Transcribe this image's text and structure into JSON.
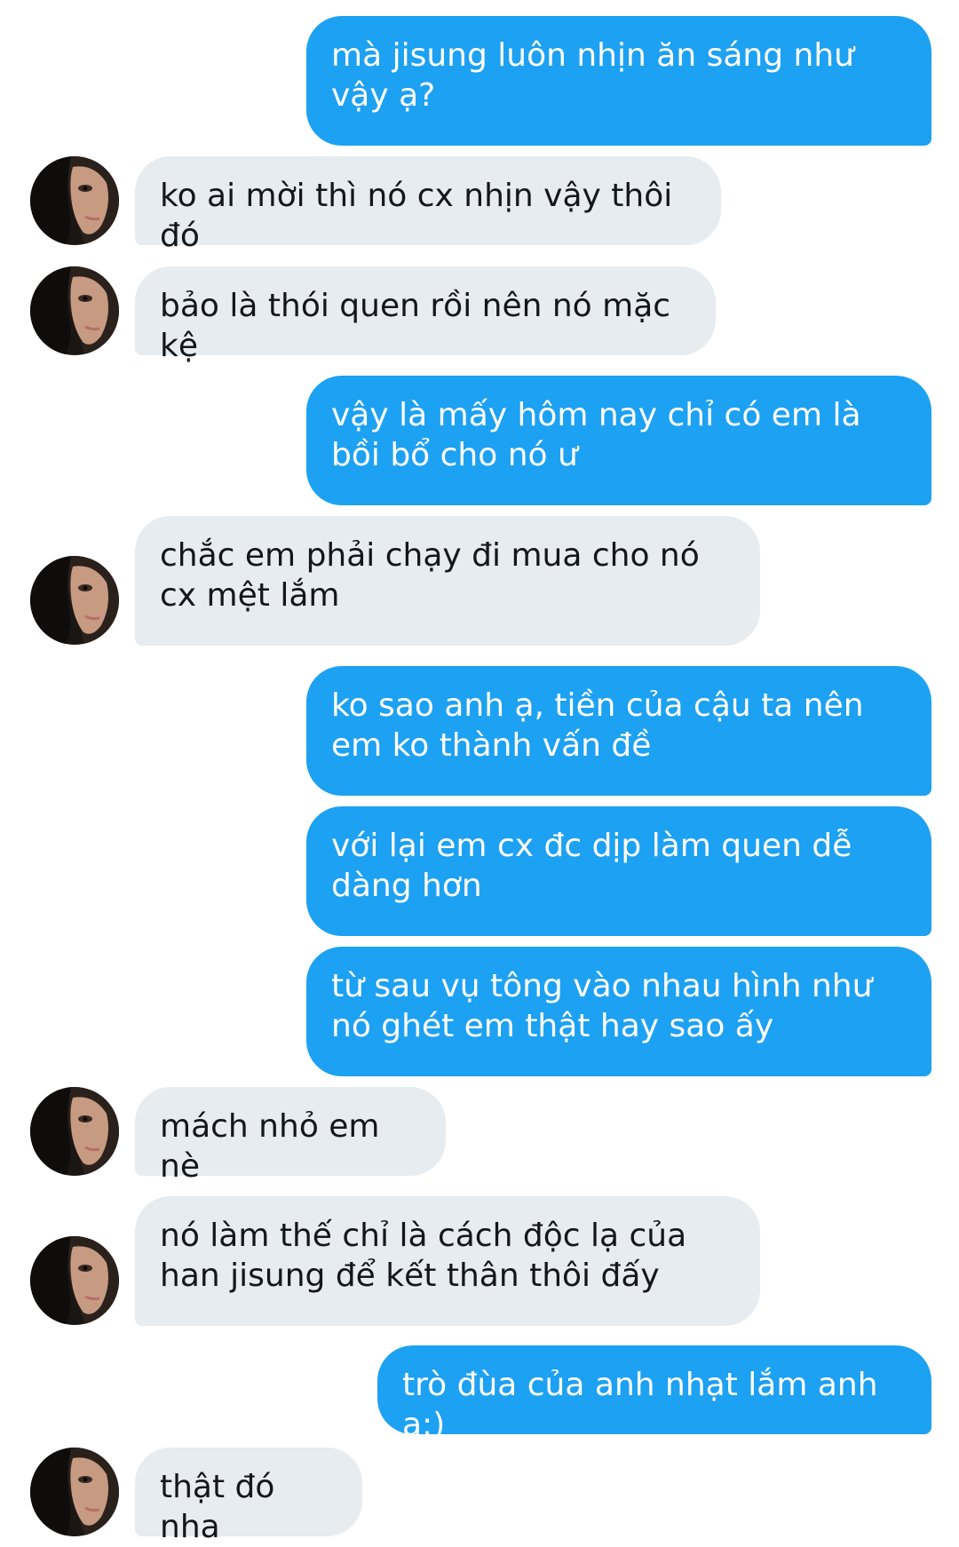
{
  "conversation": {
    "messages": [
      {
        "from": "me",
        "text": "mà jisung luôn nhịn ăn sáng như vậy ạ?"
      },
      {
        "from": "other",
        "text": "ko ai mời thì nó cx nhịn vậy thôi đó"
      },
      {
        "from": "other",
        "text": "bảo là thói quen rồi nên nó mặc kệ"
      },
      {
        "from": "me",
        "text": "vậy là mấy hôm nay chỉ có em là bồi bổ cho nó ư"
      },
      {
        "from": "other",
        "text": "chắc em phải chạy đi mua cho nó cx mệt lắm"
      },
      {
        "from": "me",
        "text": "ko sao anh ạ, tiền của cậu ta nên em ko thành vấn đề"
      },
      {
        "from": "me",
        "text": "với lại em cx đc dịp làm quen dễ dàng hơn"
      },
      {
        "from": "me",
        "text": "từ sau vụ tông vào nhau hình như nó ghét em thật hay sao ấy"
      },
      {
        "from": "other",
        "text": "mách nhỏ em nè"
      },
      {
        "from": "other",
        "text": "nó làm thế chỉ là cách độc lạ của han jisung để kết thân thôi đấy"
      },
      {
        "from": "me",
        "text": "trò đùa của anh nhạt lắm anh ạ:)"
      },
      {
        "from": "other",
        "text": "thật đó nha"
      }
    ]
  },
  "colors": {
    "sent_bubble": "#1da1f2",
    "received_bubble": "#e6ecf0"
  },
  "icons": {
    "avatar": "contact-avatar-photo"
  }
}
